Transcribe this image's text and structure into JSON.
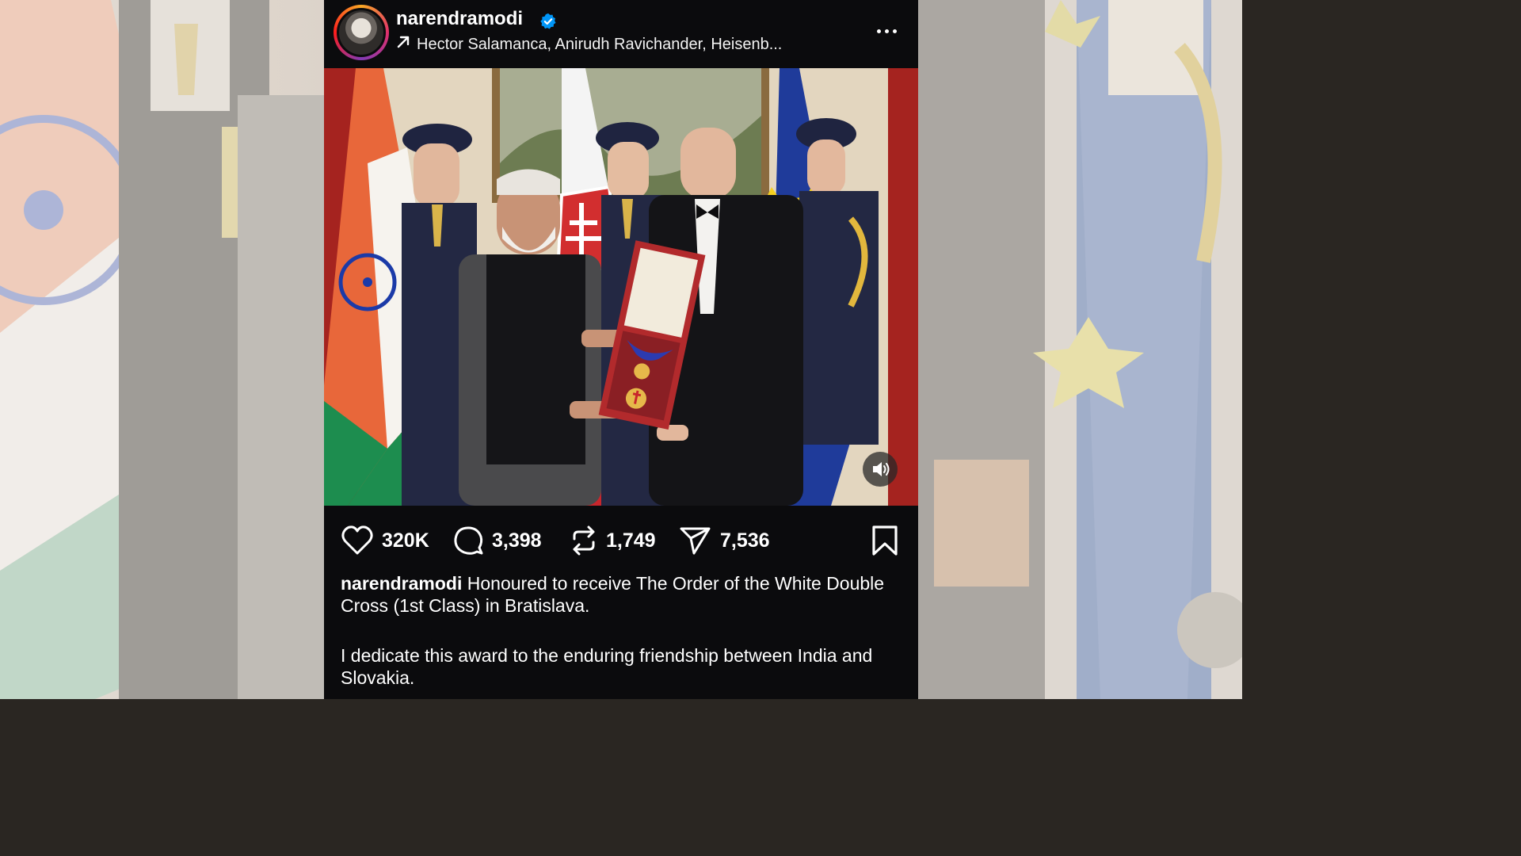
{
  "post": {
    "username": "narendramodi",
    "tagged": "Hector Salamanca, Anirudh Ravichander, Heisenb...",
    "actions": {
      "likes": "320K",
      "comments": "3,398",
      "reposts": "1,749",
      "shares": "7,536"
    },
    "caption": {
      "username": "narendramodi",
      "text": " Honoured to receive The Order of the White Double Cross (1st Class) in Bratislava.",
      "paragraph2": "I dedicate this award to the enduring friendship between India and Slovakia."
    }
  },
  "icons": [
    "verified-badge-icon",
    "tag-arrow-icon",
    "more-options-icon",
    "volume-icon",
    "heart-icon",
    "comment-icon",
    "repost-icon",
    "share-icon",
    "bookmark-icon"
  ],
  "colors": {
    "post_background": "#0b0b0d",
    "verified_blue": "#0095f6",
    "text": "#ffffff"
  }
}
